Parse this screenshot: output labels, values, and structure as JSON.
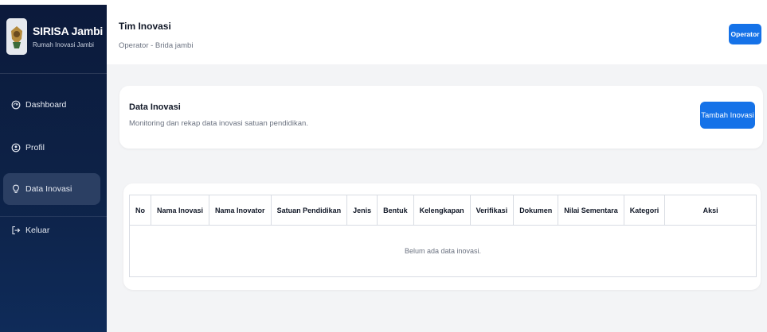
{
  "sidebar": {
    "brand_title": "SIRISA Jambi",
    "brand_subtitle": "Rumah Inovasi Jambi",
    "items": [
      {
        "label": "Dashboard",
        "icon": "dashboard-icon"
      },
      {
        "label": "Profil",
        "icon": "user-circle-icon"
      },
      {
        "label": "Data Inovasi",
        "icon": "lightbulb-icon",
        "active": true
      },
      {
        "label": "Keluar",
        "icon": "logout-icon"
      }
    ]
  },
  "header": {
    "title": "Tim Inovasi",
    "subtitle": "Operator - Brida jambi",
    "role_badge": "Operator"
  },
  "info_card": {
    "title": "Data Inovasi",
    "subtitle": "Monitoring dan rekap data inovasi satuan pendidikan.",
    "add_button": "Tambah Inovasi"
  },
  "table": {
    "columns": [
      "No",
      "Nama Inovasi",
      "Nama Inovator",
      "Satuan Pendidikan",
      "Jenis",
      "Bentuk",
      "Kelengkapan",
      "Verifikasi",
      "Dokumen",
      "Nilai Sementara",
      "Kategori",
      "Aksi"
    ],
    "empty_message": "Belum ada data inovasi."
  },
  "colors": {
    "sidebar_bg": "#0c1a3b",
    "sidebar_active": "#2b3f63",
    "accent": "#1572e8",
    "page_bg": "#f3f4f6"
  }
}
